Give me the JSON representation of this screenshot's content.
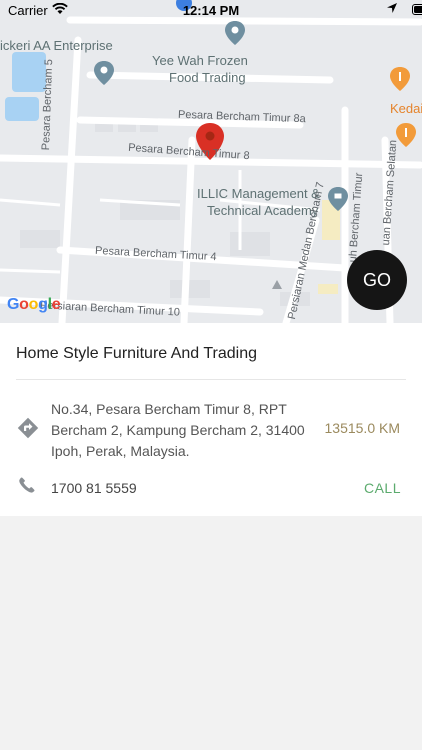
{
  "status_bar": {
    "carrier": "Carrier",
    "time": "12:14 PM"
  },
  "map": {
    "poi_labels": [
      "ickeri AA Enterprise",
      "Yee Wah Frozen",
      "Food Trading",
      "ILLIC Management &",
      "Technical Academy",
      "Kedai"
    ],
    "street_labels": [
      "Pesara Bercham Timur 8a",
      "Pesara Bercham Timur 8",
      "Pesara Bercham 5",
      "Pesara Bercham Timur 4",
      "Persiaran Bercham Timur 10",
      "Persiaran Medan Bercham 7",
      "uh Bercham Timur",
      "uan Bercham Selatan"
    ],
    "go_label": "GO",
    "google_logo": [
      "G",
      "o",
      "o",
      "g",
      "l",
      "e"
    ],
    "colors": {
      "map_bg": "#e8eaed",
      "road": "#ffffff",
      "pin": "#d93025",
      "poi_marker": "#6f8fa0",
      "food_marker": "#f29b3a"
    }
  },
  "listing": {
    "title": "Home Style Furniture And Trading",
    "address": "No.34, Pesara Bercham Timur 8, RPT Bercham 2, Kampung Bercham 2, 31400 Ipoh, Perak, Malaysia.",
    "distance": "13515.0 KM",
    "phone": "1700 81 5559",
    "call_label": "CALL",
    "icons": {
      "directions": "directions-icon",
      "phone": "phone-icon"
    }
  }
}
